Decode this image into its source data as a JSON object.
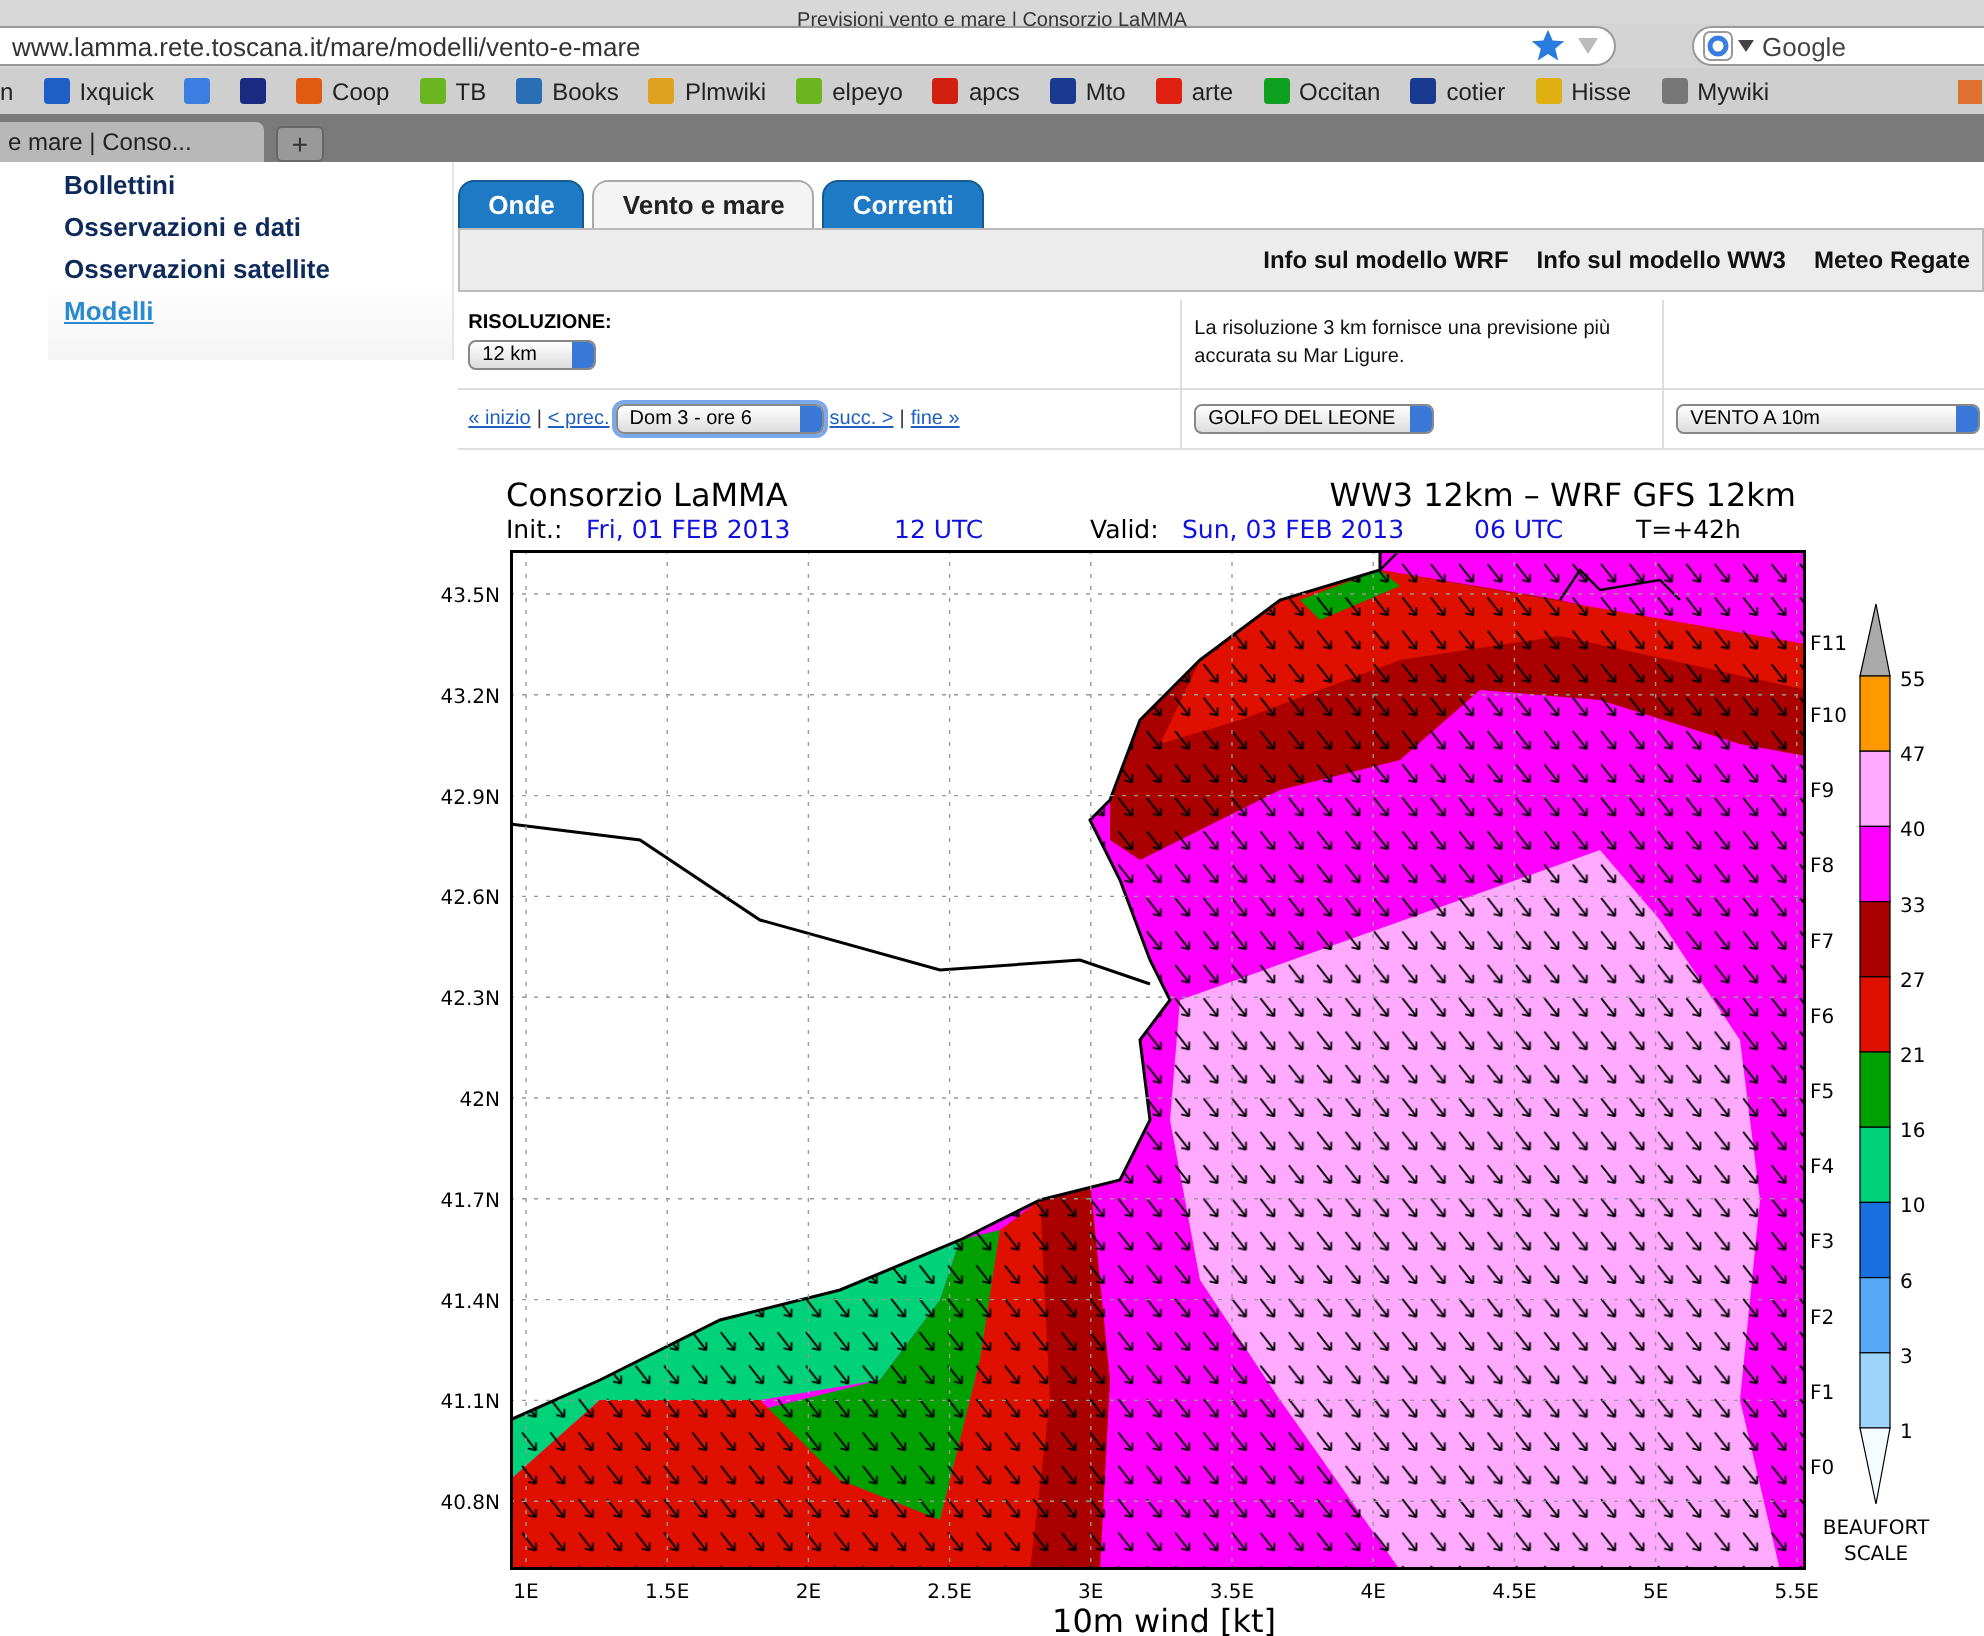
{
  "browser": {
    "title": "Previsioni vento e mare | Consorzio LaMMA",
    "url": "www.lamma.rete.toscana.it/mare/modelli/vento-e-mare",
    "search_placeholder": "Google",
    "bookmarks": [
      {
        "label": "n"
      },
      {
        "label": "Ixquick",
        "color": "#1d5fc4"
      },
      {
        "color": "#3b7de0"
      },
      {
        "color": "#1a2a80"
      },
      {
        "label": "Coop",
        "color": "#e05a10"
      },
      {
        "label": "TB",
        "color": "#6ab520"
      },
      {
        "label": "Books",
        "color": "#2a6fb5"
      },
      {
        "label": "Plmwiki",
        "color": "#e0a020"
      },
      {
        "label": "elpeyo",
        "color": "#6ab520"
      },
      {
        "label": "apcs",
        "color": "#d02010"
      },
      {
        "label": "Mto",
        "color": "#1a3a90"
      },
      {
        "label": "arte",
        "color": "#e02010"
      },
      {
        "label": "Occitan",
        "color": "#10a020"
      },
      {
        "label": "cotier",
        "color": "#1a3a90"
      },
      {
        "label": "Hisse",
        "color": "#e0b010"
      },
      {
        "label": "Mywiki",
        "color": "#777777"
      }
    ],
    "tabs": [
      {
        "label": "e mare | Conso...",
        "selected": true
      }
    ],
    "new_tab": "+"
  },
  "sidebar": {
    "items": [
      {
        "label": "Bollettini",
        "selected": false
      },
      {
        "label": "Osservazioni e dati",
        "selected": false
      },
      {
        "label": "Osservazioni satellite",
        "selected": false
      },
      {
        "label": "Modelli",
        "selected": true
      }
    ]
  },
  "tabs": [
    {
      "label": "Onde",
      "selected": false
    },
    {
      "label": "Vento e mare",
      "selected": true
    },
    {
      "label": "Correnti",
      "selected": false
    }
  ],
  "links": [
    "Info sul modello WRF",
    "Info sul modello WW3",
    "Meteo Regate"
  ],
  "resolution": {
    "label": "RISOLUZIONE:",
    "value": "12 km",
    "note": "La risoluzione 3 km fornisce una previsione più accurata su Mar Ligure."
  },
  "nav": {
    "items": [
      {
        "kind": "link",
        "label": "« inizio"
      },
      {
        "kind": "sep",
        "label": "|"
      },
      {
        "kind": "link",
        "label": "< prec."
      },
      {
        "kind": "select",
        "label": "Dom 3 - ore 6"
      },
      {
        "kind": "link",
        "label": "succ. >"
      },
      {
        "kind": "sep",
        "label": "|"
      },
      {
        "kind": "link",
        "label": "fine »"
      }
    ],
    "area": "GOLFO DEL LEONE",
    "field": "VENTO A 10m"
  },
  "map": {
    "org": "Consorzio LaMMA",
    "model": "WW3 12km – WRF GFS 12km",
    "init_label": "Init.:",
    "init_date": "Fri, 01 FEB 2013",
    "init_time": "12 UTC",
    "valid_label": "Valid:",
    "valid_date": "Sun, 03 FEB 2013",
    "valid_time": "06 UTC",
    "lead": "T=+42h",
    "lat_labels": [
      "43.5N",
      "43.2N",
      "42.9N",
      "42.6N",
      "42.3N",
      "42N",
      "41.7N",
      "41.4N",
      "41.1N",
      "40.8N"
    ],
    "lon_labels": [
      "1E",
      "1.5E",
      "2E",
      "2.5E",
      "3E",
      "3.5E",
      "4E",
      "4.5E",
      "5E",
      "5.5E"
    ],
    "xlabel": "10m wind [kt]"
  },
  "legend": {
    "top_force": "F11",
    "top_value": "55",
    "bands": [
      {
        "force": "F10",
        "color": "#ff9900",
        "lower": "47"
      },
      {
        "force": "F9",
        "color": "#ffaaff",
        "lower": "40"
      },
      {
        "force": "F8",
        "color": "#ff00ff",
        "lower": "33"
      },
      {
        "force": "F7",
        "color": "#aa0000",
        "lower": "27"
      },
      {
        "force": "F6",
        "color": "#e01000",
        "lower": "21"
      },
      {
        "force": "F5",
        "color": "#00a000",
        "lower": "16"
      },
      {
        "force": "F4",
        "color": "#00d27a",
        "lower": "10"
      },
      {
        "force": "F3",
        "color": "#1a6fe0",
        "lower": "6"
      },
      {
        "force": "F2",
        "color": "#55a8f5",
        "lower": "3"
      },
      {
        "force": "F1",
        "color": "#9dd4fa",
        "lower": "1"
      }
    ],
    "bottom_force": "F0",
    "title": [
      "BEAUFORT",
      "SCALE"
    ]
  }
}
